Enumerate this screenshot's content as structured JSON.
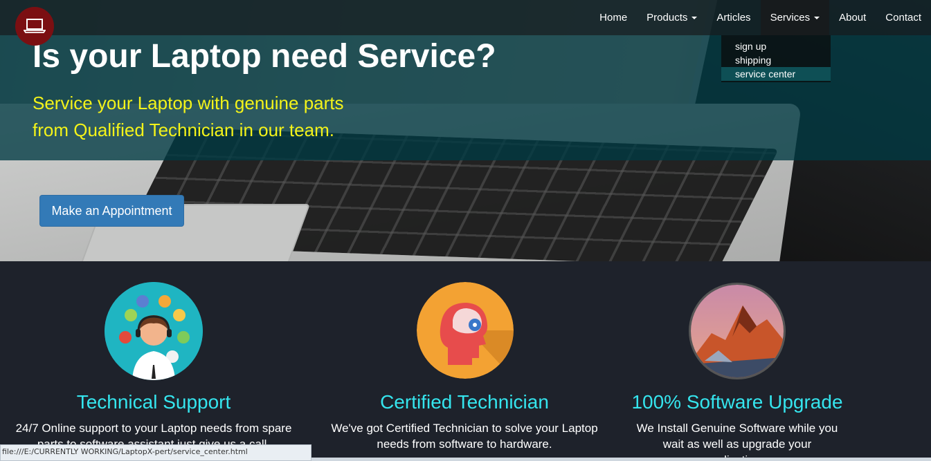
{
  "nav": {
    "items": [
      {
        "label": "Home"
      },
      {
        "label": "Products",
        "has_caret": true
      },
      {
        "label": "Articles"
      },
      {
        "label": "Services",
        "has_caret": true,
        "active": true
      },
      {
        "label": "About"
      },
      {
        "label": "Contact"
      }
    ],
    "services_dropdown": [
      "sign up",
      "shipping",
      "service center"
    ]
  },
  "hero": {
    "title": "Is your Laptop need Service?",
    "subtitle_line1": "Service your Laptop with genuine parts",
    "subtitle_line2": "from Qualified Technician in our team.",
    "cta_label": "Make an Appointment"
  },
  "features": [
    {
      "icon": "support-agent-icon",
      "title": "Technical Support",
      "text_line1": "24/7 Online support to your Laptop needs from spare",
      "text_line2": "parts to software assistant just give us a call."
    },
    {
      "icon": "brain-head-icon",
      "title": "Certified Technician",
      "text_line1": "We've got Certified Technician to solve your Laptop",
      "text_line2": "needs from software to hardware."
    },
    {
      "icon": "mountain-icon",
      "title": "100% Software Upgrade",
      "text_line1": "We Install Genuine Software while you",
      "text_line2": "wait as well as upgrade your",
      "text_line3": "applications."
    }
  ],
  "status_bar": "file:///E:/CURRENTLY WORKING/LaptopX-pert/service_center.html",
  "colors": {
    "overlay": "#003a42",
    "accent_yellow": "#f3f31a",
    "feature_title": "#35e5ee",
    "cta_blue": "#337ab7",
    "logo_red": "#7b0f12",
    "features_bg": "#1e222b"
  }
}
